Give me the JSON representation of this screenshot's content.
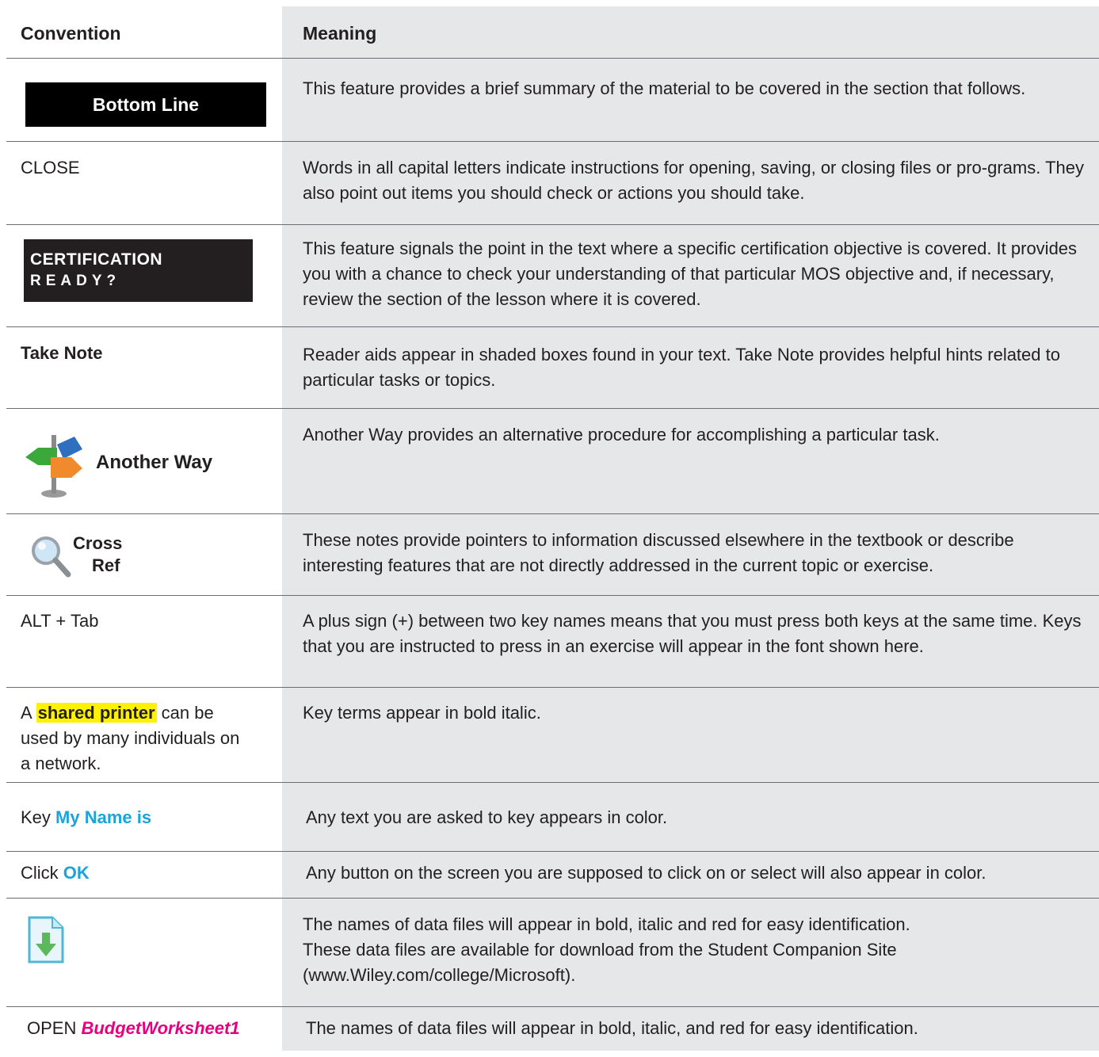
{
  "header": {
    "convention": "Convention",
    "meaning": "Meaning"
  },
  "rows": [
    {
      "convention": "Bottom Line",
      "meaning": "This feature provides a brief summary of the material to be covered in the section that follows."
    },
    {
      "convention": "CLOSE",
      "meaning": "Words in all capital letters indicate instructions for opening, saving, or closing files or pro-grams. They also point out items you should check or actions you should take."
    },
    {
      "convention_line1": "CERTIFICATION",
      "convention_line2": "READY?",
      "meaning": "This feature signals the point in the text where a specific certification objective is covered. It provides you with a chance to check your understanding of that particular MOS objective and, if necessary, review the section of the lesson where it is covered."
    },
    {
      "convention": "Take Note",
      "meaning": "Reader aids appear in shaded boxes found in your text. Take Note provides helpful hints related to particular tasks or topics."
    },
    {
      "convention": "Another Way",
      "icon": "signpost-icon",
      "meaning": "Another Way provides an alternative procedure for accomplishing a particular task."
    },
    {
      "convention_line1": "Cross",
      "convention_line2": "Ref",
      "icon": "magnifier-icon",
      "meaning": "These notes provide pointers to information discussed elsewhere in the textbook or describe interesting features that are not directly addressed in the current topic or exercise."
    },
    {
      "convention": "ALT + Tab",
      "meaning": "A plus sign (+) between two key names means that you must press both keys at the same time. Keys that you are instructed to press in an exercise will appear in the font shown here."
    },
    {
      "convention_pre": "A ",
      "convention_term": "shared printer",
      "convention_post": " can be used by many individuals on a network.",
      "meaning": "Key terms appear in bold italic."
    },
    {
      "convention_pre": "Key ",
      "convention_value": "My Name is",
      "meaning": "Any text you are asked to key appears in color."
    },
    {
      "convention_pre": "Click ",
      "convention_value": "OK",
      "meaning": "Any button on the screen you are supposed to click on or select will also appear in color."
    },
    {
      "icon": "download-file-icon",
      "meaning_line1": "The names of data files will appear in bold, italic and red for easy identification.",
      "meaning_line2": "These data files are available for download from the Student Companion Site (www.Wiley.com/college/Microsoft)."
    },
    {
      "convention_pre": "OPEN ",
      "convention_value": "BudgetWorksheet1",
      "meaning": "The names of data files will appear in bold, italic, and red for easy identification."
    }
  ],
  "colors": {
    "shade": "#e6e7e8",
    "highlight": "#fff200",
    "key_color": "#1ba3dc",
    "file_color": "#e6007e"
  }
}
